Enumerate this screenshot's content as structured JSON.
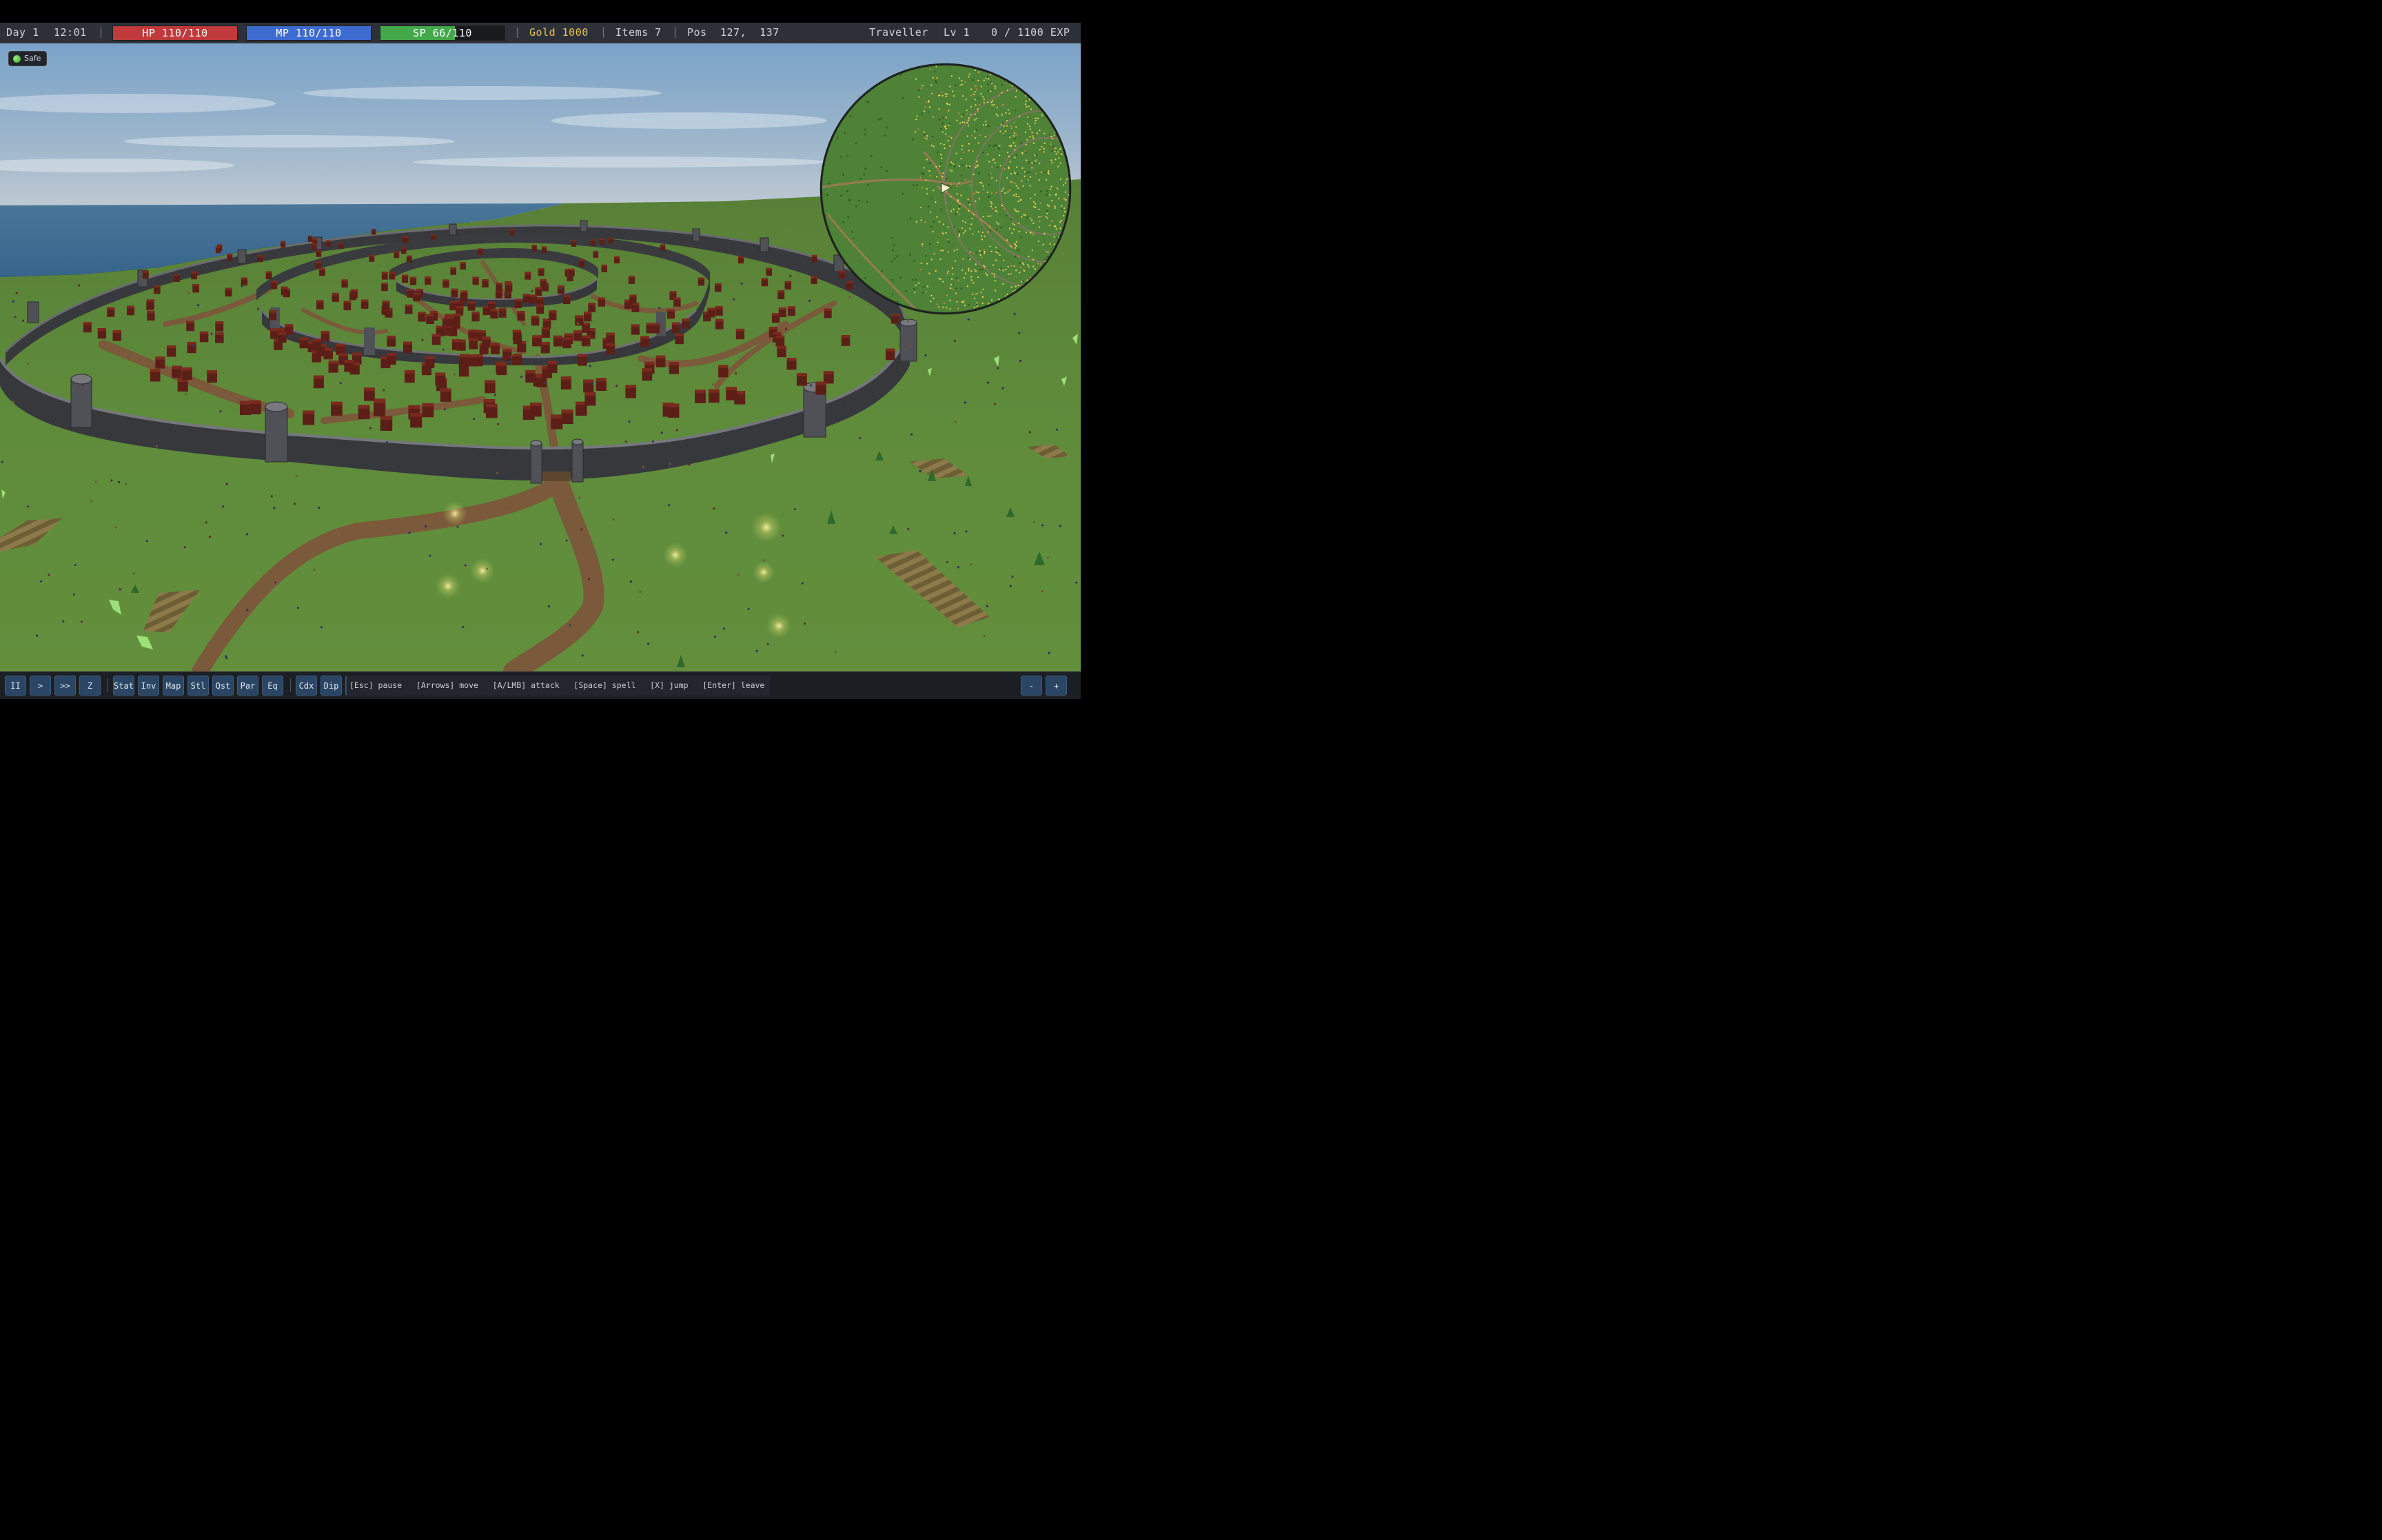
{
  "hud": {
    "day": "Day 1",
    "time": "12:01",
    "hp": {
      "label": "HP 110/110",
      "current": 110,
      "max": 110
    },
    "mp": {
      "label": "MP 110/110",
      "current": 110,
      "max": 110
    },
    "sp": {
      "label": "SP 66/110",
      "current": 66,
      "max": 110
    },
    "gold": "Gold 1000",
    "items": "Items 7",
    "pos_label": "Pos",
    "pos_value": "127,  137",
    "player_name": "Traveller",
    "level": "Lv 1",
    "exp": "0 / 1100 EXP",
    "separator": "|"
  },
  "status": {
    "label": "Safe"
  },
  "toolbar": {
    "speed_buttons": [
      "II",
      ">",
      ">>",
      "Z"
    ],
    "panel_buttons": [
      "Stat",
      "Inv",
      "Map",
      "Stl",
      "Qst",
      "Par",
      "Eq"
    ],
    "extra_buttons": [
      "Cdx",
      "Dip"
    ],
    "help": "[Esc] pause   [Arrows] move   [A/LMB] attack   [Space] spell   [X] jump   [Enter] leave",
    "zoom_out": "-",
    "zoom_in": "+"
  },
  "colors": {
    "hp": "#c0393b",
    "mp": "#3d6bd0",
    "sp": "#43a84a",
    "gold": "#e6c15a",
    "grass": "#5e8a3a",
    "wall": "#3a3b3f",
    "roof": "#5c1f17",
    "water": "#3d6e95"
  },
  "icons": {
    "status": "safe-dot-icon",
    "minimap_player": "player-arrow-icon"
  }
}
